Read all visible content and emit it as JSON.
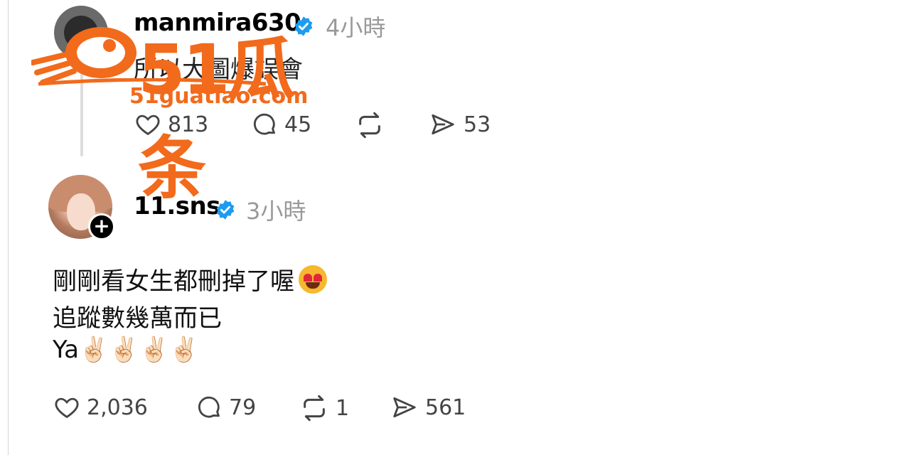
{
  "post1": {
    "username": "manmira630",
    "time": "4小時",
    "text": "所以大圖爆誤會",
    "actions": {
      "likes": "813",
      "comments": "45",
      "reposts": "",
      "shares": "53"
    }
  },
  "post2": {
    "username": "11.sns",
    "time": "3小時",
    "lines": [
      "剛剛看女生都刪掉了喔",
      "追蹤數幾萬而已",
      "Ya✌🏻✌🏻✌🏻✌🏻"
    ],
    "actions": {
      "likes": "2,036",
      "comments": "79",
      "reposts": "1",
      "shares": "561"
    }
  },
  "watermark": {
    "brand": "51瓜条",
    "url": "51guatiao.com"
  },
  "colors": {
    "verified": "#1d9bf0",
    "watermark": "#f26a1b",
    "muted": "#999999"
  },
  "icons": [
    "heart-icon",
    "comment-icon",
    "repost-icon",
    "share-icon",
    "verified-badge-icon",
    "plus-icon"
  ]
}
